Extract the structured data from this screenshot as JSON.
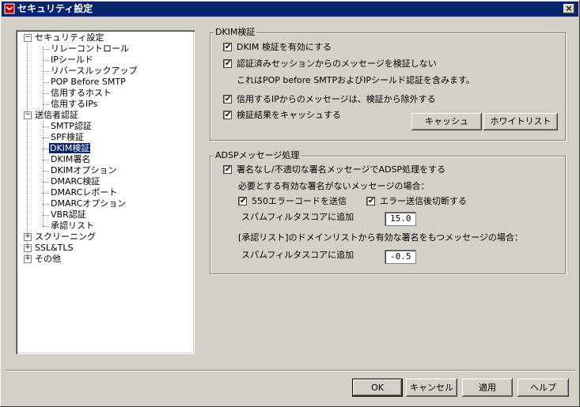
{
  "window": {
    "title": "セキュリティ設定",
    "close_label": "×"
  },
  "tree": {
    "root_security": "セキュリティ設定",
    "security_children": [
      "リレーコントロール",
      "IPシールド",
      "リバースルックアップ",
      "POP Before SMTP",
      "信用するホスト",
      "信用するIPs"
    ],
    "root_sender_auth": "送信者認証",
    "sender_children": [
      "SMTP認証",
      "SPF検証",
      "DKIM検証",
      "DKIM署名",
      "DKIMオプション",
      "DMARC検証",
      "DMARCレポート",
      "DMARCオプション",
      "VBR認証",
      "承認リスト"
    ],
    "root_screening": "スクリーニング",
    "root_ssl": "SSL&TLS",
    "root_other": "その他",
    "selected": "DKIM検証"
  },
  "dkim": {
    "group_title": "DKIM検証",
    "enable": "DKIM 検証を有効にする",
    "no_verify_authed": "認証済みセッションからのメッセージを検証しない",
    "note": "これはPOP before SMTPおよびIPシールド認証を含みます。",
    "exclude_trusted_ip": "信用するIPからのメッセージは、検証から除外する",
    "cache_results": "検証結果をキャッシュする",
    "cache_button": "キャッシュ",
    "whitelist_button": "ホワイトリスト"
  },
  "adsp": {
    "group_title": "ADSPメッセージ処理",
    "process": "署名なし/不適切な署名メッセージでADSP処理をする",
    "no_valid_sig_label": "必要とする有効な署名がないメッセージの場合：",
    "send_550": "550エラーコードを送信",
    "disconnect": "エラー送信後切断する",
    "spam_score_label_1": "スパムフィルタスコアに追加",
    "spam_score_value_1": "15.0",
    "approved_list_label": "[承認リスト]のドメインリストから有効な署名をもつメッセージの場合：",
    "spam_score_label_2": "スパムフィルタスコアに追加",
    "spam_score_value_2": "-0.5"
  },
  "footer": {
    "ok": "OK",
    "cancel": "キャンセル",
    "apply": "適用",
    "help": "ヘルプ"
  }
}
